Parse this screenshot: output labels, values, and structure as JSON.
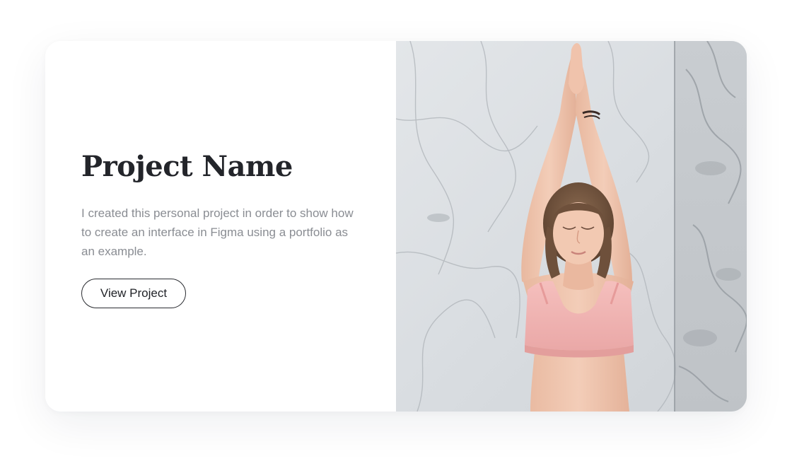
{
  "project": {
    "title": "Project Name",
    "description": "I created this personal project in order to show how to create an interface in Figma using a portfolio as an example.",
    "button_label": "View Project"
  },
  "colors": {
    "title": "#23252a",
    "description": "#8a8d93",
    "button_border": "#2a2c31",
    "card_background": "#ffffff",
    "page_background": "#ffffff",
    "photo_skin": "#f0c6ae",
    "photo_top": "#f2b4b2",
    "photo_hair": "#7a5a42",
    "photo_marble": "#d4d8dc"
  }
}
